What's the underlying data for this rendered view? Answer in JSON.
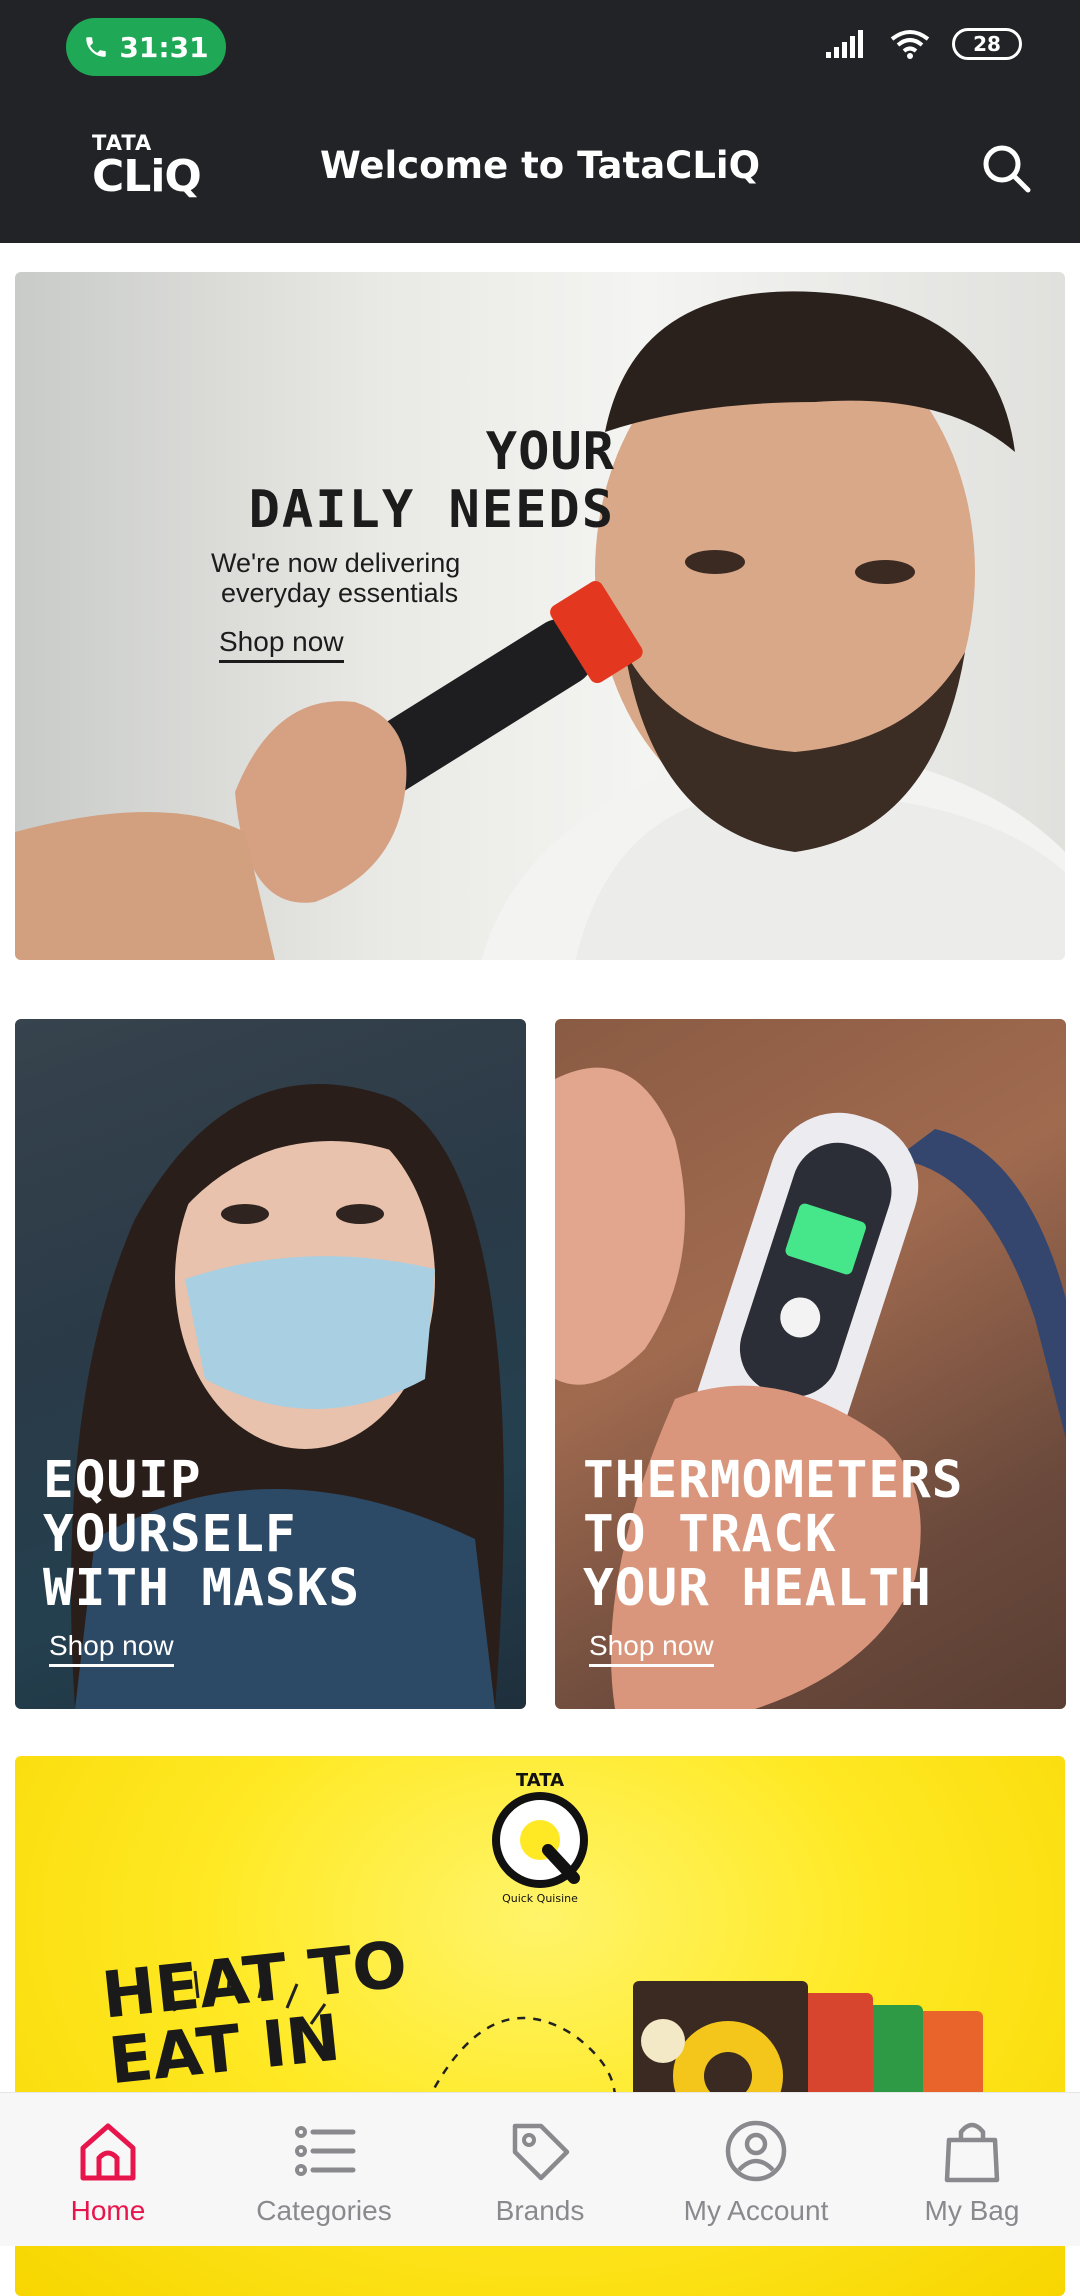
{
  "status_bar": {
    "call_timer": "31:31",
    "battery": "28"
  },
  "app_bar": {
    "logo_top": "TATA",
    "logo_bottom": "CLiQ",
    "title": "Welcome to TataCLiQ"
  },
  "hero_banner": {
    "title_line1": "YOUR",
    "title_line2": "DAILY NEEDS",
    "subtitle_line1": "We're now delivering",
    "subtitle_line2": "everyday essentials",
    "cta": "Shop now"
  },
  "tiles": [
    {
      "title_line1": "EQUIP",
      "title_line2": "YOURSELF",
      "title_line3": "WITH MASKS",
      "cta": "Shop now"
    },
    {
      "title_line1": "THERMOMETERS",
      "title_line2": "TO TRACK",
      "title_line3": "YOUR HEALTH",
      "cta": "Shop now"
    }
  ],
  "quisine_banner": {
    "brand_top": "TATA",
    "brand_letter": "Q",
    "brand_sub": "Quick Quisine",
    "headline_line1": "HEAT TO",
    "headline_line2": "EAT IN"
  },
  "bottom_nav": {
    "items": [
      {
        "label": "Home",
        "icon": "home-icon",
        "active": true
      },
      {
        "label": "Categories",
        "icon": "list-icon",
        "active": false
      },
      {
        "label": "Brands",
        "icon": "tag-icon",
        "active": false
      },
      {
        "label": "My Account",
        "icon": "user-circle-icon",
        "active": false
      },
      {
        "label": "My Bag",
        "icon": "bag-icon",
        "active": false
      }
    ]
  },
  "colors": {
    "header_bg": "#222326",
    "accent": "#e7154b",
    "call_green": "#1fa855",
    "quisine_yellow": "#ffe924"
  }
}
